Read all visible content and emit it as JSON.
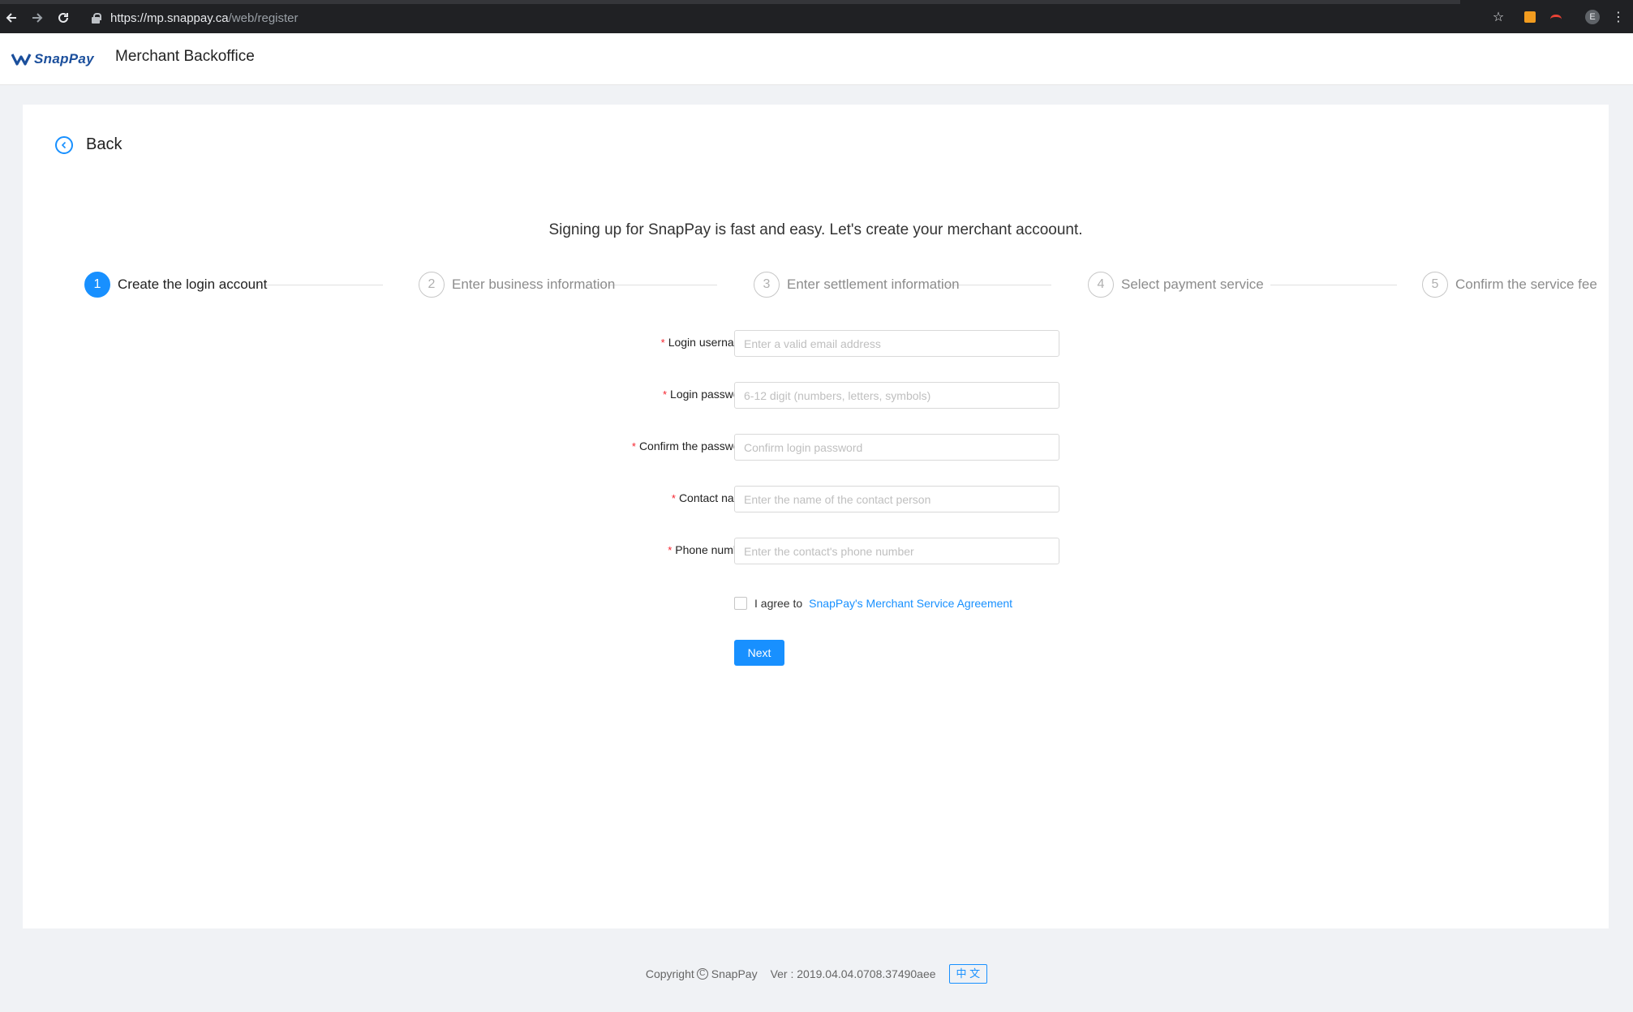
{
  "browser": {
    "url_host": "https://mp.snappay.ca",
    "url_path": "/web/register",
    "back_icon": "arrow-left-icon",
    "forward_icon": "arrow-right-icon",
    "reload_icon": "reload-icon",
    "profile_initial": "E"
  },
  "header": {
    "logo_text": "SnapPay",
    "title": "Merchant Backoffice",
    "brand_color": "#1b4f9c"
  },
  "back": {
    "label": "Back",
    "icon": "chevron-left-circle-icon"
  },
  "intro": "Signing up for SnapPay is fast and easy. Let's create your merchant accoount.",
  "steps": [
    {
      "num": "1",
      "title": "Create the login account",
      "active": true
    },
    {
      "num": "2",
      "title": "Enter business information",
      "active": false
    },
    {
      "num": "3",
      "title": "Enter settlement information",
      "active": false
    },
    {
      "num": "4",
      "title": "Select payment service",
      "active": false
    },
    {
      "num": "5",
      "title": "Confirm the service fee",
      "active": false
    }
  ],
  "form": {
    "required_mark": "*",
    "fields": [
      {
        "label": "Login username",
        "placeholder": "Enter a valid email address",
        "value": ""
      },
      {
        "label": "Login password",
        "placeholder": "6-12 digit (numbers, letters, symbols)",
        "value": ""
      },
      {
        "label": "Confirm the password",
        "placeholder": "Confirm login password",
        "value": ""
      },
      {
        "label": "Contact name",
        "placeholder": "Enter the name of the contact person",
        "value": ""
      },
      {
        "label": "Phone number",
        "placeholder": "Enter the contact's phone number",
        "value": ""
      }
    ],
    "label_suffix": ":",
    "agree_text": "I agree to",
    "agree_link": "SnapPay's Merchant Service Agreement",
    "agree_checked": false,
    "next_label": "Next"
  },
  "footer": {
    "copyright_prefix": "Copyright",
    "copyright_owner": "SnapPay",
    "version": "Ver : 2019.04.04.0708.37490aee",
    "language_toggle": "中 文"
  },
  "colors": {
    "accent": "#1890ff",
    "required": "#f5222d",
    "page_bg": "#f0f2f5"
  }
}
